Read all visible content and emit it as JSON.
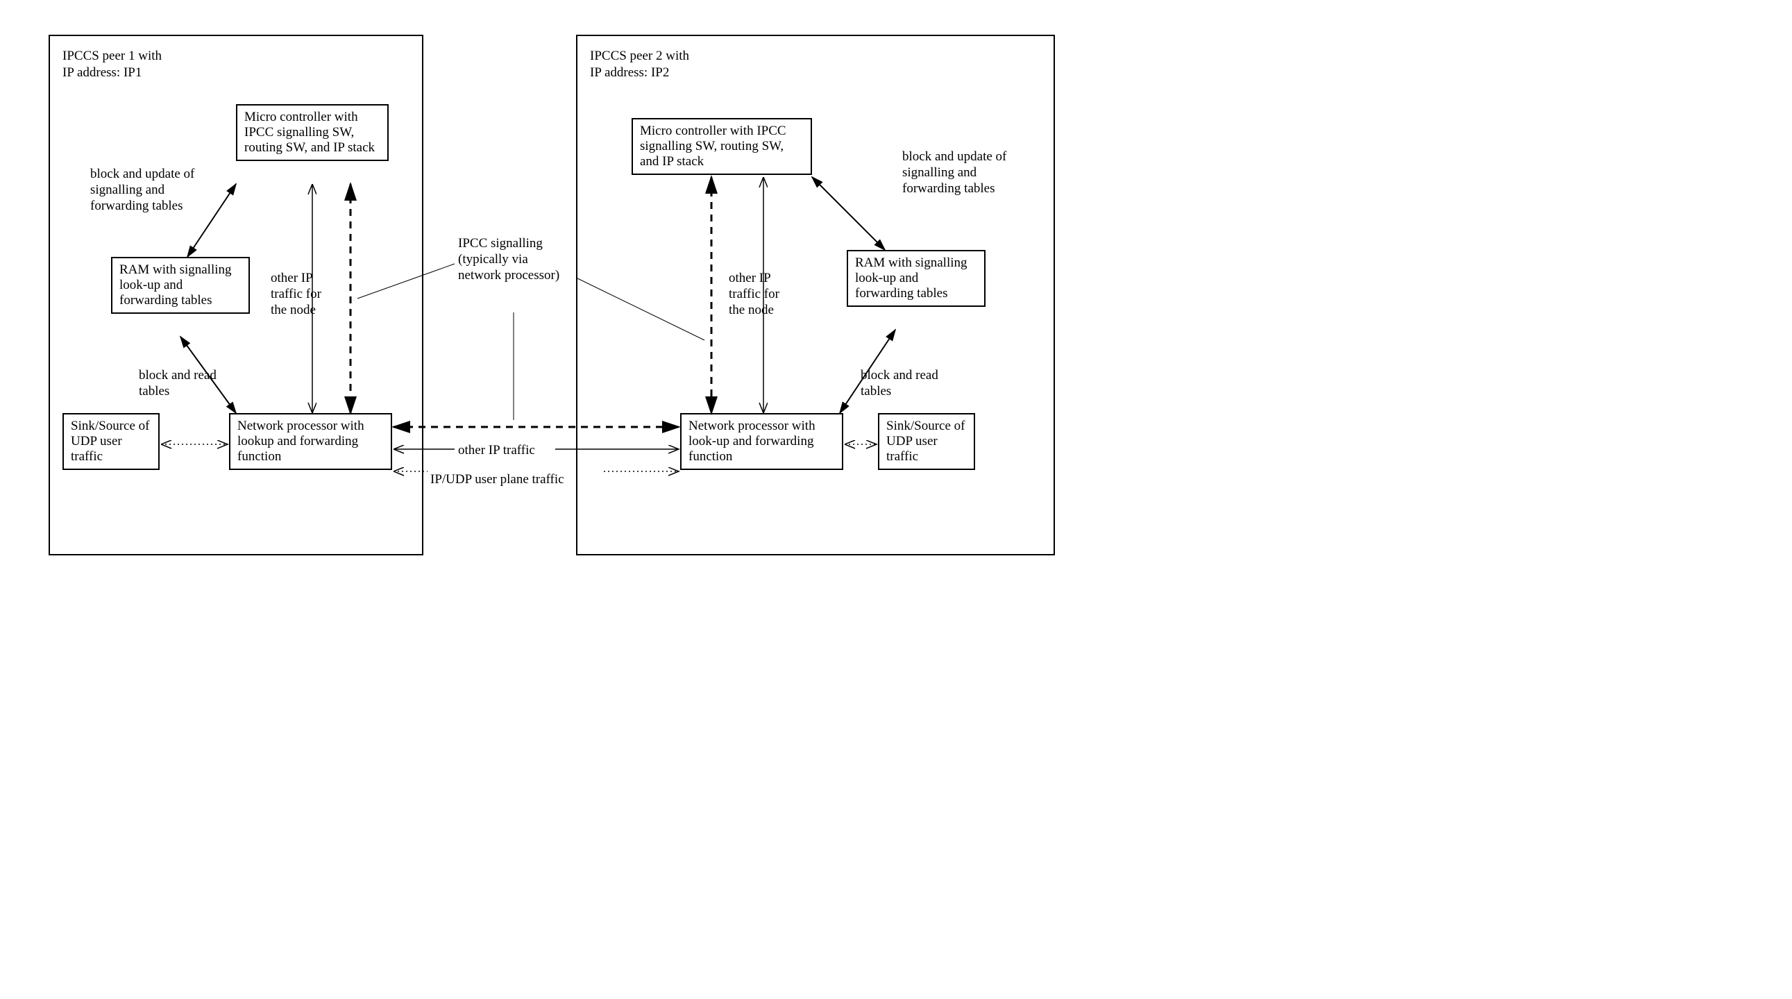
{
  "peer1": {
    "title_line1": "IPCCS peer 1 with",
    "title_line2": "IP address: IP1",
    "micro": "Micro controller with IPCC signalling SW, routing SW,  and IP stack",
    "ram": "RAM with signalling look-up and forwarding tables",
    "netproc": "Network processor with lookup and forwarding function",
    "sink": "Sink/Source of UDP  user traffic",
    "label_block_update": "block and update of signalling and forwarding tables",
    "label_other_ip": "other IP traffic for the node",
    "label_block_read": "block and read tables"
  },
  "peer2": {
    "title_line1": "IPCCS peer 2 with",
    "title_line2": "IP address: IP2",
    "micro": "Micro controller with IPCC signalling SW, routing SW, and IP stack",
    "ram": "RAM with signalling look-up and forwarding tables",
    "netproc": "Network processor with look-up and forwarding function",
    "sink": "Sink/Source of UDP  user traffic",
    "label_block_update": "block and update of signalling and forwarding tables",
    "label_other_ip": "other IP traffic for the node",
    "label_block_read": "block and read tables"
  },
  "center": {
    "ipcc_signalling": "IPCC signalling (typically via network processor)",
    "other_ip": "other IP traffic",
    "udp_plane": "IP/UDP user plane traffic"
  }
}
